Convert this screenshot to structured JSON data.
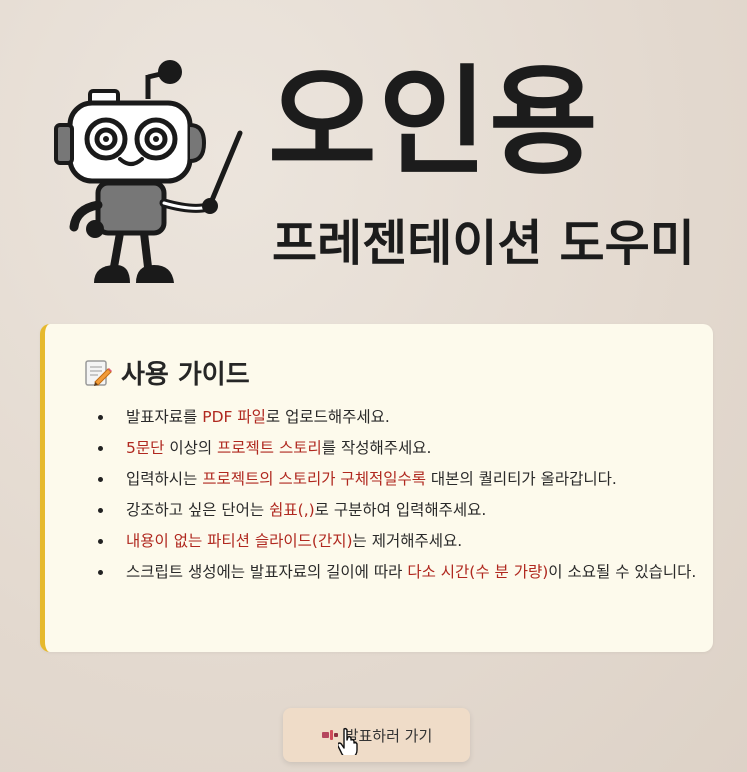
{
  "hero": {
    "title": "오인용",
    "subtitle": "프레젠테이션 도우미"
  },
  "guide": {
    "icon": "memo-icon",
    "title": "사용 가이드",
    "items": [
      {
        "parts": [
          {
            "t": "발표자료를 "
          },
          {
            "t": "PDF 파일",
            "hl": true
          },
          {
            "t": "로 업로드해주세요."
          }
        ]
      },
      {
        "parts": [
          {
            "t": "5문단",
            "hl": true
          },
          {
            "t": " 이상의 "
          },
          {
            "t": "프로젝트 스토리",
            "hl": true
          },
          {
            "t": "를 작성해주세요."
          }
        ]
      },
      {
        "parts": [
          {
            "t": "입력하시는 "
          },
          {
            "t": "프로젝트의 스토리가 구체적일수록",
            "hl": true
          },
          {
            "t": " 대본의 퀄리티가 올라갑니다."
          }
        ]
      },
      {
        "parts": [
          {
            "t": "강조하고 싶은 단어는 "
          },
          {
            "t": "쉼표(,)",
            "hl": true
          },
          {
            "t": "로 구분하여 입력해주세요."
          }
        ]
      },
      {
        "parts": [
          {
            "t": "내용이 없는 파티션 슬라이드(간지)",
            "hl": true
          },
          {
            "t": "는 제거해주세요."
          }
        ]
      },
      {
        "parts": [
          {
            "t": "스크립트 생성에는 발표자료의 길이에 따라 "
          },
          {
            "t": "다소 시간(수 분 가량)",
            "hl": true
          },
          {
            "t": "이 소요될 수 있습니다."
          }
        ]
      }
    ]
  },
  "action": {
    "button_label": "발표하러 가기",
    "button_icon": "projector-icon"
  },
  "colors": {
    "highlight": "#b0281f",
    "accent_border": "#e6b92d",
    "card_bg": "#fdfaec",
    "button_bg": "#efdcc8"
  }
}
